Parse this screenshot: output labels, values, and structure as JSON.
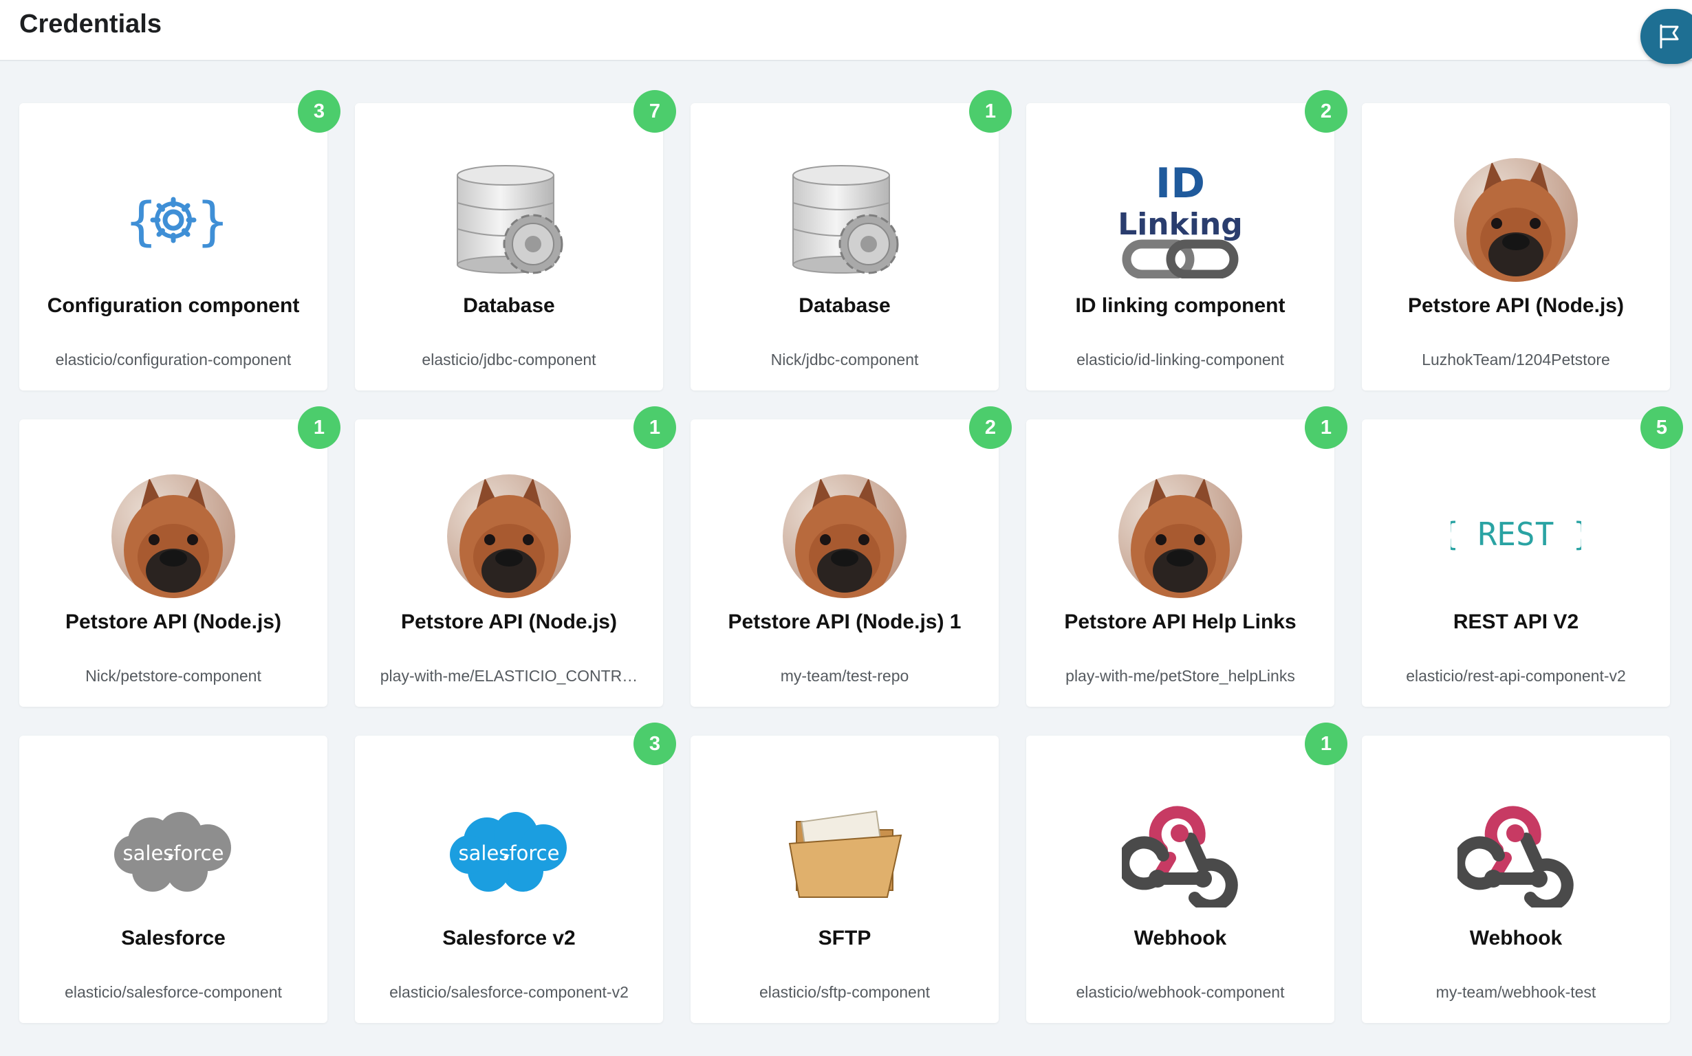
{
  "header": {
    "title": "Credentials"
  },
  "cards": [
    {
      "title": "Configuration component",
      "subtitle": "elasticio/configuration-component",
      "badge": "3",
      "icon": "config-icon"
    },
    {
      "title": "Database",
      "subtitle": "elasticio/jdbc-component",
      "badge": "7",
      "icon": "database-icon"
    },
    {
      "title": "Database",
      "subtitle": "Nick/jdbc-component",
      "badge": "1",
      "icon": "database-icon"
    },
    {
      "title": "ID linking component",
      "subtitle": "elasticio/id-linking-component",
      "badge": "2",
      "icon": "id-linking-icon",
      "icon_text": [
        "ID",
        "Linking"
      ]
    },
    {
      "title": "Petstore API (Node.js)",
      "subtitle": "LuzhokTeam/1204Petstore",
      "badge": "",
      "icon": "dog-avatar-icon"
    },
    {
      "title": "Petstore API (Node.js)",
      "subtitle": "Nick/petstore-component",
      "badge": "1",
      "icon": "dog-avatar-icon"
    },
    {
      "title": "Petstore API (Node.js)",
      "subtitle": "play-with-me/ELASTICIO_CONTR…",
      "badge": "1",
      "icon": "dog-avatar-icon"
    },
    {
      "title": "Petstore API (Node.js) 1",
      "subtitle": "my-team/test-repo",
      "badge": "2",
      "icon": "dog-avatar-icon"
    },
    {
      "title": "Petstore API Help Links",
      "subtitle": "play-with-me/petStore_helpLinks",
      "badge": "1",
      "icon": "dog-avatar-icon"
    },
    {
      "title": "REST API V2",
      "subtitle": "elasticio/rest-api-component-v2",
      "badge": "5",
      "icon": "rest-icon",
      "icon_text": [
        "{ REST }"
      ]
    },
    {
      "title": "Salesforce",
      "subtitle": "elasticio/salesforce-component",
      "badge": "",
      "icon": "salesforce-gray-icon",
      "icon_text": [
        "salesforce"
      ]
    },
    {
      "title": "Salesforce v2",
      "subtitle": "elasticio/salesforce-component-v2",
      "badge": "3",
      "icon": "salesforce-blue-icon",
      "icon_text": [
        "salesforce"
      ]
    },
    {
      "title": "SFTP",
      "subtitle": "elasticio/sftp-component",
      "badge": "",
      "icon": "folder-icon"
    },
    {
      "title": "Webhook",
      "subtitle": "elasticio/webhook-component",
      "badge": "1",
      "icon": "webhook-icon"
    },
    {
      "title": "Webhook",
      "subtitle": "my-team/webhook-test",
      "badge": "",
      "icon": "webhook-icon"
    }
  ],
  "colors": {
    "badge": "#4ccd6c",
    "feedback_button": "#1e6f93",
    "config_icon": "#3f8fd6",
    "rest_icon": "#2aa3a3",
    "salesforce_blue": "#1b9ee0",
    "salesforce_gray": "#8e8e8e",
    "webhook_red": "#c73a63",
    "id_linking_blue": "#1f5a9c"
  },
  "feedback": {
    "icon": "flag-icon"
  }
}
